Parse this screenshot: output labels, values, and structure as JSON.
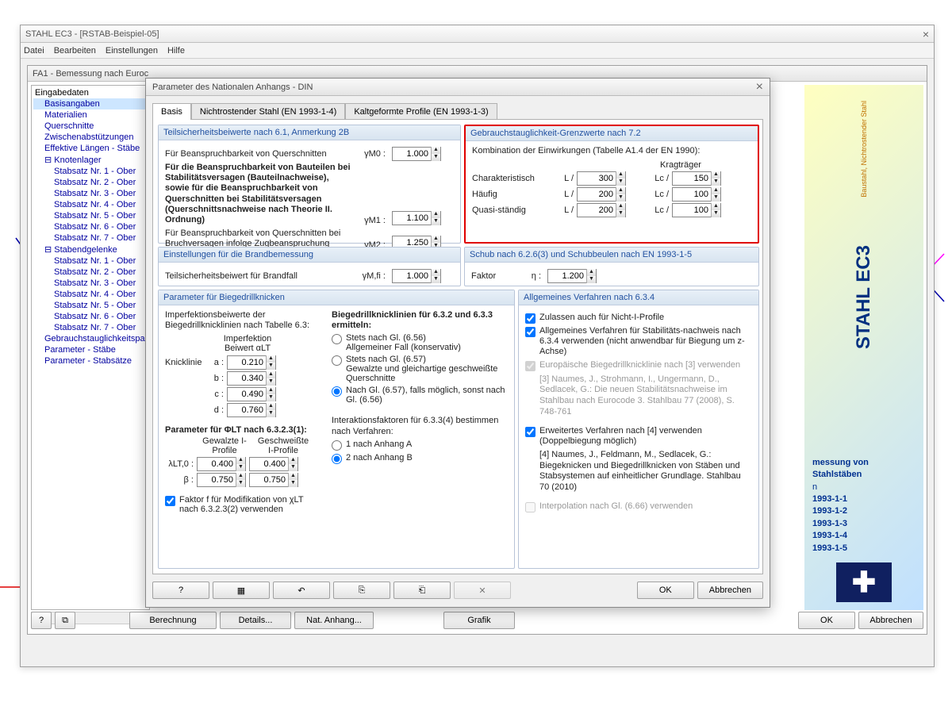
{
  "app": {
    "title": "STAHL EC3 - [RSTAB-Beispiel-05]",
    "menu": {
      "file": "Datei",
      "edit": "Bearbeiten",
      "settings": "Einstellungen",
      "help": "Hilfe"
    },
    "module_title": "FA1 - Bemessung nach Euroc"
  },
  "tree": {
    "root": "Eingabedaten",
    "items": [
      "Basisangaben",
      "Materialien",
      "Querschnitte",
      "Zwischenabstützungen",
      "Effektive Längen - Stäbe"
    ],
    "knotenlager": "Knotenlager",
    "stabsatz_prefix": "Stabsatz Nr.",
    "stabsatz_suffix": " - Ober",
    "stabend": "Stabendgelenke",
    "footer": [
      "Gebrauchstauglichkeitspa",
      "Parameter - Stäbe",
      "Parameter - Stabsätze"
    ]
  },
  "dialog": {
    "title": "Parameter des Nationalen Anhangs - DIN",
    "tabs": {
      "t1": "Basis",
      "t2": "Nichtrostender Stahl (EN 1993-1-4)",
      "t3": "Kaltgeformte Profile (EN 1993-1-3)"
    },
    "g_safety": {
      "head": "Teilsicherheitsbeiwerte nach 6.1, Anmerkung 2B",
      "l1": "Für Beanspruchbarkeit von Querschnitten",
      "l2": "Für die Beanspruchbarkeit von Bauteilen bei Stabilitätsversagen (Bauteilnachweise), sowie für die Beanspruchbarkeit von Querschnitten bei Stabilitätsversagen (Querschnittsnachweise nach Theorie II. Ordnung)",
      "l3": "Für Beanspruchbarkeit von Querschnitten bei Bruchversagen infolge Zugbeanspruchung",
      "s1": "γM0 :",
      "v1": "1.000",
      "s2": "γM1 :",
      "v2": "1.100",
      "s3": "γM2 :",
      "v3": "1.250"
    },
    "g_service": {
      "head": "Gebrauchstauglichkeit-Grenzwerte nach 7.2",
      "sub": "Kombination der Einwirkungen (Tabelle A1.4 der EN 1990):",
      "col_cant": "Kragträger",
      "r1": "Charakteristisch",
      "r2": "Häufig",
      "r3": "Quasi-ständig",
      "L": "L /",
      "Lc": "Lc /",
      "v1a": "300",
      "v1b": "150",
      "v2a": "200",
      "v2b": "100",
      "v3a": "200",
      "v3b": "100"
    },
    "g_fire": {
      "head": "Einstellungen für die Brandbemessung",
      "l1": "Teilsicherheitsbeiwert für Brandfall",
      "s1": "γM,fi :",
      "v1": "1.000"
    },
    "g_shear": {
      "head": "Schub nach 6.2.6(3) und Schubbeulen nach EN 1993-1-5",
      "l1": "Faktor",
      "s1": "η :",
      "v1": "1.200"
    },
    "g_ltb": {
      "head": "Parameter für Biegedrillknicken",
      "intro": "Imperfektionsbeiwerte der Biegedrillknicklinien nach Tabelle 6.3:",
      "col1": "Imperfektion Beiwert αLT",
      "kl": "Knicklinie",
      "a": "a :",
      "va": "0.210",
      "b": "b :",
      "vb": "0.340",
      "c": "c :",
      "vc": "0.490",
      "d": "d :",
      "vd": "0.760",
      "phi_head": "Parameter für ΦLT nach 6.3.2.3(1):",
      "ph_c1": "Gewalzte I-Profile",
      "ph_c2": "Geschweißte I-Profile",
      "lam": "λLT,0 :",
      "vlam1": "0.400",
      "vlam2": "0.400",
      "beta": "β :",
      "vb1": "0.750",
      "vb2": "0.750",
      "chk_f": "Faktor f für Modifikation von χLT nach 6.3.2.3(2) verwenden",
      "curve_head": "Biegedrillknicklinien für 6.3.2 und 6.3.3 ermitteln:",
      "o1": "Stets nach Gl. (6.56)",
      "o1s": "Allgemeiner Fall (konservativ)",
      "o2": "Stets nach Gl. (6.57)",
      "o2s": "Gewalzte und gleichartige geschweißte Querschnitte",
      "o3": "Nach Gl. (6.57), falls möglich, sonst nach Gl. (6.56)",
      "inter_head": "Interaktionsfaktoren für 6.3.3(4) bestimmen nach Verfahren:",
      "i1": "1 nach Anhang A",
      "i2": "2 nach Anhang B"
    },
    "g_general": {
      "head": "Allgemeines Verfahren nach 6.3.4",
      "c1": "Zulassen auch für Nicht-I-Profile",
      "c2": "Allgemeines Verfahren für Stabilitäts-nachweis nach 6.3.4 verwenden (nicht anwendbar für Biegung um z-Achse)",
      "c3": "Europäische Biegedrillknicklinie nach [3] verwenden",
      "ref3": "[3] Naumes, J., Strohmann, I., Ungermann, D., Sedlacek, G.: Die neuen Stabilitätsnachweise im Stahlbau nach Eurocode 3. Stahlbau 77 (2008), S. 748-761",
      "c4": "Erweitertes Verfahren nach [4] verwenden (Doppelbiegung möglich)",
      "ref4": "[4] Naumes, J., Feldmann, M., Sedlacek, G.: Biegeknicken und Biegedrillknicken von Stäben und Stabsystemen auf einheitlicher Grundlage. Stahlbau 70 (2010)",
      "c5": "Interpolation nach Gl. (6.66) verwenden"
    },
    "btn_ok": "OK",
    "btn_cancel": "Abbrechen"
  },
  "brand": {
    "name": "STAHL EC3",
    "sub": "Baustahl, Nichtrostender Stahl",
    "refhead": "messung von Stahlstäben",
    "refs": [
      "1993-1-1",
      "1993-1-2",
      "1993-1-3",
      "1993-1-4",
      "1993-1-5"
    ]
  },
  "buttons": {
    "calc": "Berechnung",
    "details": "Details...",
    "natanhang": "Nat. Anhang...",
    "grafik": "Grafik",
    "ok": "OK",
    "cancel": "Abbrechen"
  }
}
